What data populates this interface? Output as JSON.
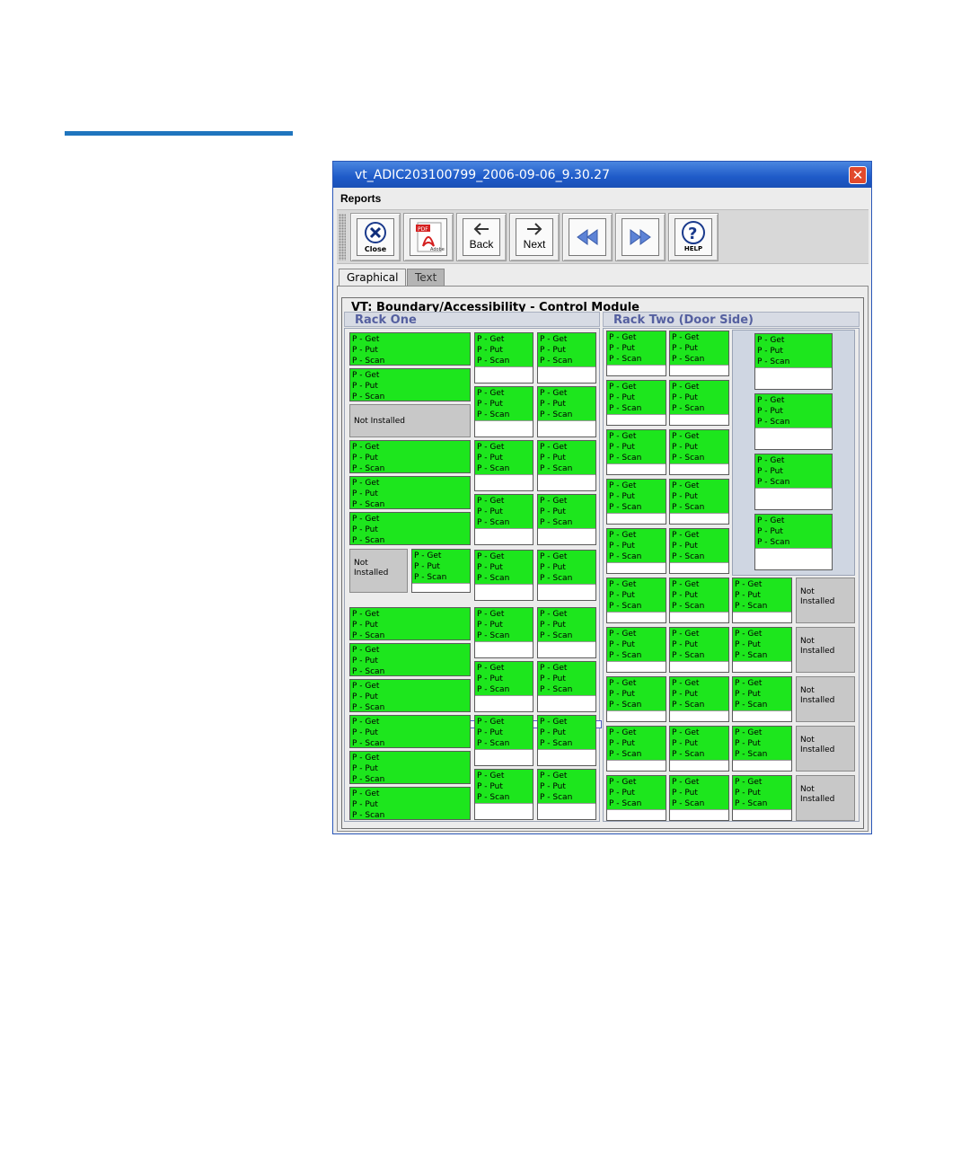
{
  "window": {
    "title": "vt_ADIC203100799_2006-09-06_9.30.27",
    "close_glyph": "✕"
  },
  "menu": {
    "reports": "Reports"
  },
  "toolbar": {
    "close_label": "Close",
    "back_label": "Back",
    "next_label": "Next",
    "help_label": "HELP",
    "pdf_label": "PDF",
    "adobe_label": "Adobe"
  },
  "tabs": {
    "graphical": "Graphical",
    "text": "Text"
  },
  "panel": {
    "title": "VT: Boundary/Accessibility - Control Module"
  },
  "racks": {
    "one": "Rack One",
    "two": "Rack Two (Door Side)"
  },
  "slot": {
    "get": "P - Get",
    "put": "P - Put",
    "scan": "P - Scan"
  },
  "status": {
    "not_installed": "Not Installed",
    "not": "Not",
    "installed": "Installed"
  },
  "colors": {
    "slot_green": "#1de61d",
    "not_installed": "#c8c8c8",
    "title_blue": "#1e5ac8"
  }
}
